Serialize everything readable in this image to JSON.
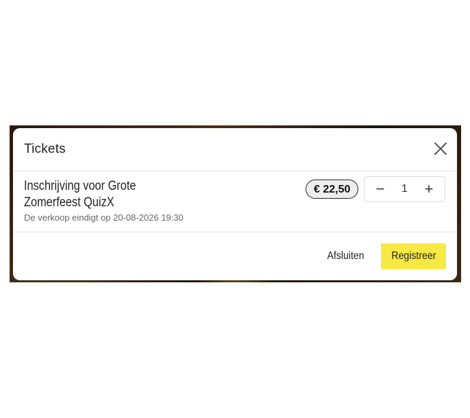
{
  "modal": {
    "title": "Tickets",
    "close_icon": "close-icon"
  },
  "ticket": {
    "name": "Inschrijving voor Grote Zomerfeest QuizX",
    "sale_end": "De verkoop eindigt op 20-08-2026 19:30",
    "price": "€ 22,50",
    "quantity": "1",
    "minus_label": "−",
    "plus_label": "+"
  },
  "footer": {
    "close_label": "Afsluiten",
    "register_label": "Registreer"
  },
  "colors": {
    "accent": "#f7e843",
    "border": "#e2e2e2",
    "price_bg": "#eeeeee"
  }
}
